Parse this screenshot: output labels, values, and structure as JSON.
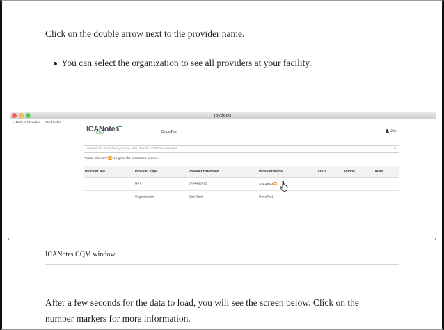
{
  "doc": {
    "instruction": "Click on the double arrow next to the provider name.",
    "bullet": "You can select the organization to see all providers at your facility.",
    "caption": "ICANotes CQM window",
    "after_text_line1": "After a few seconds for the data to load, you will see the screen below. Click on the",
    "after_text_line2": "number markers for more information."
  },
  "screenshot": {
    "window_title": "joydocu",
    "menu": [
      "← Back to ICANotes",
      "Need Help?"
    ],
    "logo_main": "ICANotes",
    "logo_sub": "CQM",
    "org_name": "DocuTest",
    "user_name": "Joy",
    "search_placeholder": "Search for Provider by Name, NPI, Tax ID, or Phone Number",
    "search_clear": "×",
    "hint_before": "Please click on \"",
    "hint_icon": "⏩",
    "hint_after": "\" to go to the measures screen.",
    "table": {
      "headers": [
        "Provider NPI",
        "Provider Type",
        "Provider Extension",
        "Provider Name",
        "Tax ID",
        "Phone",
        "Team"
      ],
      "rows": [
        [
          "",
          "NPI",
          "8734458713",
          "Joy Zepp",
          "",
          "",
          ""
        ],
        [
          "",
          "Organization",
          "DocuTest",
          "DocuTest",
          "",
          "",
          ""
        ]
      ]
    }
  }
}
